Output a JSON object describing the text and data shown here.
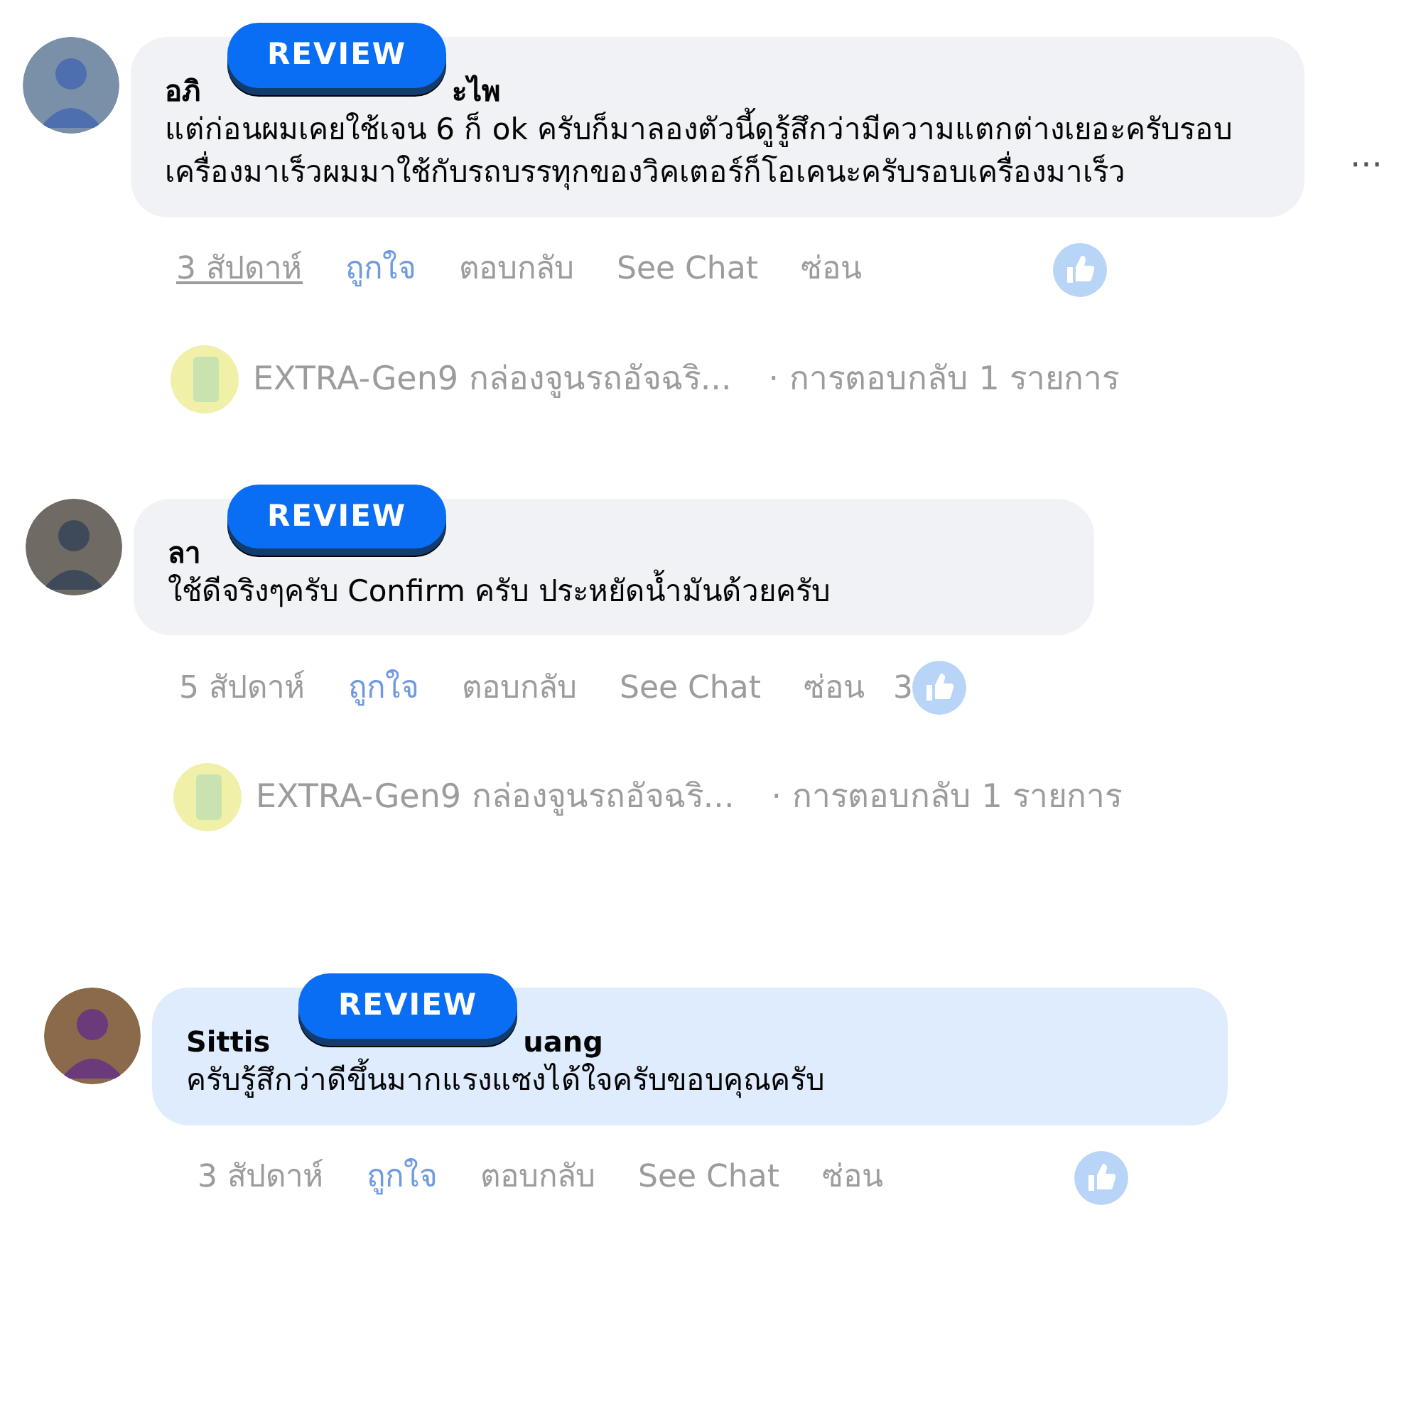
{
  "comments": [
    {
      "name_parts": [
        "อภิ",
        "ะไพ"
      ],
      "badge": "REVIEW",
      "highlighted": false,
      "text": "แต่ก่อนผมเคยใช้เจน 6 ก็ ok ครับก็มาลองตัวนี้ดูรู้สึกว่ามีความแตกต่างเยอะครับรอบเครื่องมาเร็วผมมาใช้กับรถบรรทุกของวิคเตอร์ก็โอเคนะครับรอบเครื่องมาเร็ว",
      "more": "···",
      "time": "3 สัปดาห์",
      "time_hovered": true,
      "like": "ถูกใจ",
      "liked": true,
      "reply": "ตอบกลับ",
      "see_chat": "See Chat",
      "hide": "ซ่อน",
      "reply_preview": {
        "name": "EXTRA-Gen9 กล่องจูนรถอัจฉริ...",
        "count": "· การตอบกลับ 1 รายการ"
      }
    },
    {
      "name_parts": [
        "ลา"
      ],
      "badge": "REVIEW",
      "highlighted": false,
      "text": "ใช้ดีจริงๆครับ Confirm ครับ ประหยัดน้ำมันด้วยครับ",
      "time": "5 สัปดาห์",
      "time_hovered": false,
      "like": "ถูกใจ",
      "liked": true,
      "reply": "ตอบกลับ",
      "see_chat": "See Chat",
      "hide": "ซ่อน",
      "reaction_count": "3",
      "reply_preview": {
        "name": "EXTRA-Gen9 กล่องจูนรถอัจฉริ...",
        "count": "· การตอบกลับ 1 รายการ"
      }
    },
    {
      "name_parts": [
        "Sittis",
        "uang"
      ],
      "badge": "REVIEW",
      "highlighted": true,
      "text": "ครับรู้สึกว่าดีขึ้นมากแรงแซงได้ใจครับขอบคุณครับ",
      "time": "3 สัปดาห์",
      "time_hovered": false,
      "like": "ถูกใจ",
      "liked": true,
      "reply": "ตอบกลับ",
      "see_chat": "See Chat",
      "hide": "ซ่อน"
    }
  ]
}
